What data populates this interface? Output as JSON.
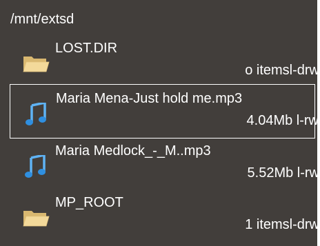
{
  "path": "/mnt/extsd",
  "items": [
    {
      "name": "LOST.DIR",
      "meta": "o itemsl-drw",
      "icon": "folder-icon",
      "selected": false
    },
    {
      "name": "Maria Mena-Just hold me.mp3",
      "meta": "4.04Mb l-rw",
      "icon": "music-note-icon",
      "selected": true
    },
    {
      "name": "Maria Medlock_-_M..mp3",
      "meta": "5.52Mb l-rw",
      "icon": "music-note-icon",
      "selected": false
    },
    {
      "name": "MP_ROOT",
      "meta": "1 itemsl-drw",
      "icon": "folder-icon",
      "selected": false
    }
  ],
  "colors": {
    "background": "#423e3b",
    "text": "#ffffff",
    "folder": "#f3d99a",
    "note": "#2f8fe0"
  }
}
